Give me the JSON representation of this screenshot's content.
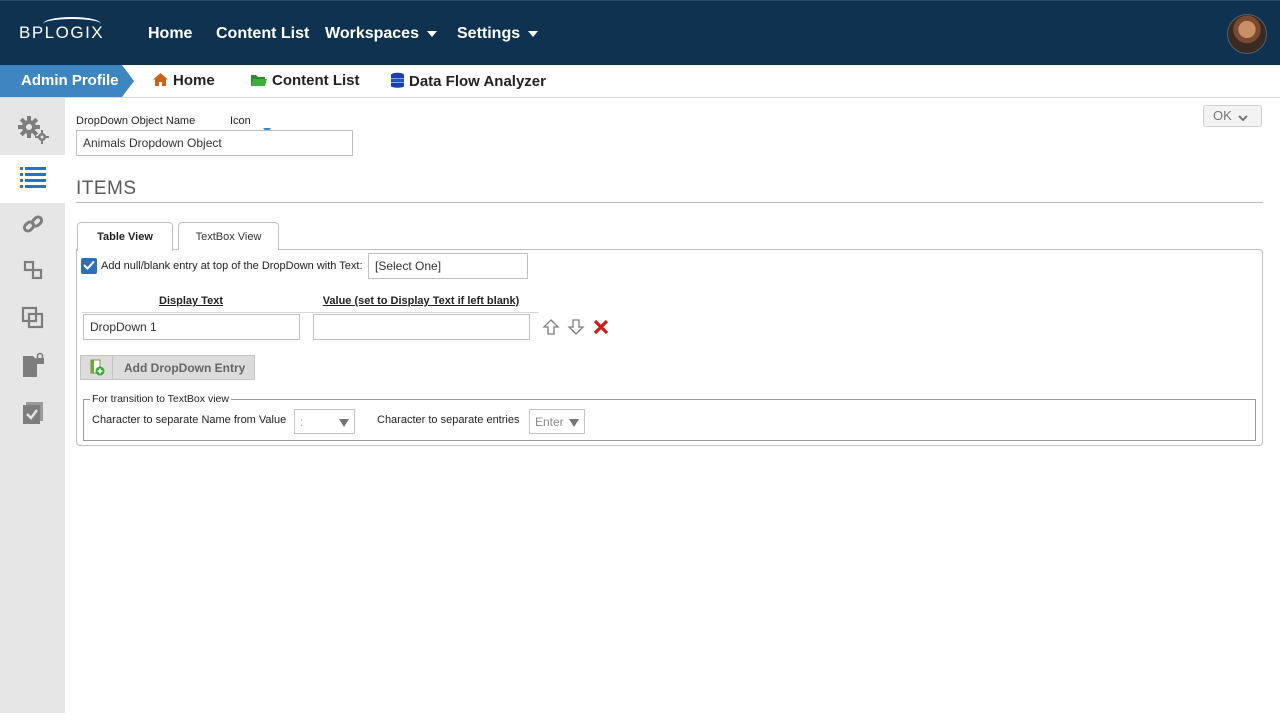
{
  "topnav": {
    "logo": "BPLOGIX",
    "items": [
      {
        "label": "Home",
        "has_dropdown": false
      },
      {
        "label": "Content List",
        "has_dropdown": false
      },
      {
        "label": "Workspaces",
        "has_dropdown": true
      },
      {
        "label": "Settings",
        "has_dropdown": true
      }
    ]
  },
  "breadcrumb": {
    "current": "Admin Profile",
    "links": [
      {
        "label": "Home",
        "icon": "home-icon"
      },
      {
        "label": "Content List",
        "icon": "folder-icon"
      },
      {
        "label": "Data Flow Analyzer",
        "icon": "database-icon"
      }
    ]
  },
  "sidebar": {
    "items": [
      {
        "icon": "gears-icon",
        "active": false
      },
      {
        "icon": "list-icon",
        "active": true
      },
      {
        "icon": "link-icon",
        "active": false
      },
      {
        "icon": "flow-icon",
        "active": false
      },
      {
        "icon": "copy-icon",
        "active": false
      },
      {
        "icon": "locked-document-icon",
        "active": false
      },
      {
        "icon": "checked-document-icon",
        "active": false
      }
    ]
  },
  "form": {
    "name_label": "DropDown Object Name",
    "icon_label": "Icon",
    "name_value": "Animals Dropdown Object",
    "ok_label": "OK"
  },
  "items": {
    "heading": "ITEMS",
    "tabs": [
      {
        "label": "Table View",
        "active": true
      },
      {
        "label": "TextBox View",
        "active": false
      }
    ],
    "null_entry_label": "Add null/blank entry at top of the DropDown with Text:",
    "null_entry_checked": true,
    "null_entry_value": "[Select One]",
    "columns": {
      "display_text": "Display Text",
      "value": "Value (set to Display Text if left blank)"
    },
    "rows": [
      {
        "display_text": "DropDown 1",
        "value": ""
      }
    ],
    "add_entry_label": "Add DropDown Entry"
  },
  "transition": {
    "legend": "For transition to TextBox view",
    "name_value_sep_label": "Character to separate Name from Value",
    "name_value_sep_value": ":",
    "entries_sep_label": "Character to separate entries",
    "entries_sep_value": "Enter"
  },
  "colors": {
    "topbar": "#0e3250",
    "accent": "#3e86c2",
    "sidebar_active": "#1f77c7",
    "delete": "#d11a1a"
  }
}
